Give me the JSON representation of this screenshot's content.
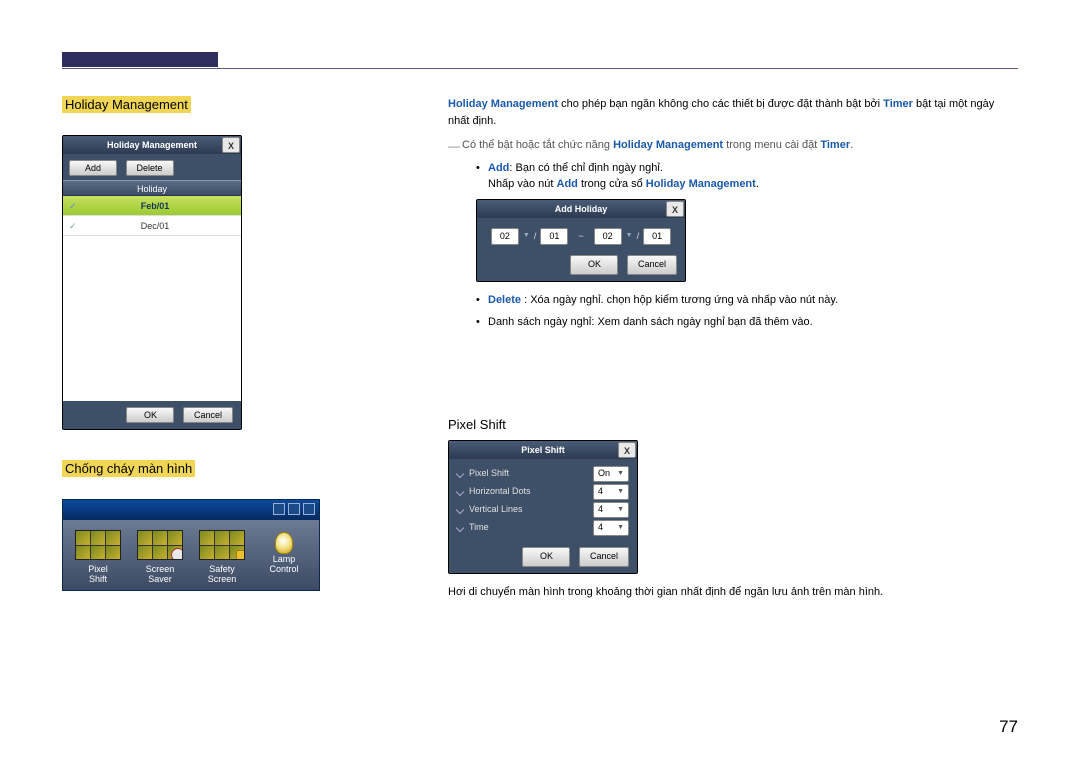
{
  "section1": {
    "heading": "Holiday Management",
    "dialog": {
      "title": "Holiday Management",
      "addBtn": "Add",
      "deleteBtn": "Delete",
      "colHeader": "Holiday",
      "rows": [
        "Feb/01",
        "Dec/01"
      ],
      "okBtn": "OK",
      "cancelBtn": "Cancel"
    }
  },
  "section2": {
    "heading": "Chống cháy màn hình",
    "items": [
      {
        "l1": "Pixel",
        "l2": "Shift"
      },
      {
        "l1": "Screen",
        "l2": "Saver"
      },
      {
        "l1": "Safety",
        "l2": "Screen"
      },
      {
        "l1": "Lamp",
        "l2": "Control"
      }
    ]
  },
  "intro": {
    "hm": "Holiday Management",
    "timer": "Timer",
    "text1a": " cho phép bạn ngăn không cho các thiết bị được đặt thành bật bởi ",
    "text1b": " bật tại một ngày nhất định.",
    "dashNote_a": "Có thể bật hoặc tắt chức năng ",
    "dashNote_b": " trong menu cài đặt ",
    "dashNote_c": ".",
    "addLabel": "Add",
    "addLine": ": Bạn có thể chỉ định ngày nghỉ.",
    "addLine2_a": "Nhấp vào nút ",
    "addLine2_b": " trong cửa sổ ",
    "addLine2_c": ".",
    "deleteLabel": "Delete",
    "deleteLine": " : Xóa ngày nghỉ. chọn hộp kiểm tương ứng và nhấp vào nút này.",
    "listLine": "Danh sách ngày nghỉ: Xem danh sách ngày nghỉ bạn đã thêm vào."
  },
  "addHoliday": {
    "title": "Add Holiday",
    "m1": "02",
    "d1": "01",
    "m2": "02",
    "d2": "01",
    "okBtn": "OK",
    "cancelBtn": "Cancel"
  },
  "pixelShift": {
    "heading": "Pixel Shift",
    "title": "Pixel Shift",
    "r1": "Pixel Shift",
    "v1": "On",
    "r2": "Horizontal Dots",
    "v2": "4",
    "r3": "Vertical Lines",
    "v3": "4",
    "r4": "Time",
    "v4": "4",
    "okBtn": "OK",
    "cancelBtn": "Cancel",
    "after": "Hơi di chuyển màn hình trong khoảng thời gian nhất định để ngăn lưu ảnh trên màn hình."
  },
  "pageNumber": "77"
}
